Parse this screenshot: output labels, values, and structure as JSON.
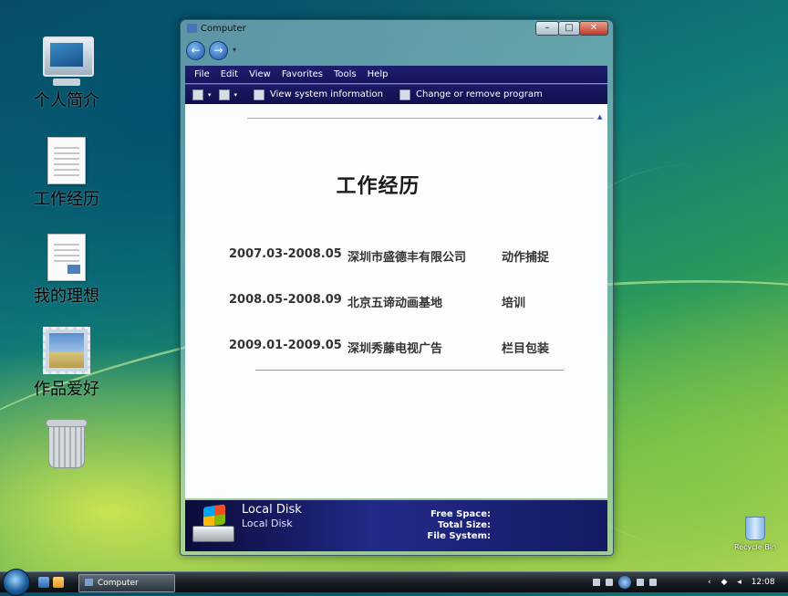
{
  "desktop": {
    "icons": [
      {
        "label": "个人简介",
        "icon": "computer-icon"
      },
      {
        "label": "工作经历",
        "icon": "document-icon"
      },
      {
        "label": "我的理想",
        "icon": "document-image-icon"
      },
      {
        "label": "作品爱好",
        "icon": "picture-frame-icon"
      },
      {
        "label": "",
        "icon": "trash-icon"
      }
    ],
    "recycle_bin_label": "Recycle Bin"
  },
  "window": {
    "title": "Computer",
    "controls": {
      "minimize": "–",
      "maximize": "□",
      "close": "✕"
    },
    "nav": {
      "back": "←",
      "forward": "→",
      "dropdown": "▾"
    },
    "menu": [
      "File",
      "Edit",
      "View",
      "Favorites",
      "Tools",
      "Help"
    ],
    "commands": {
      "views_dropdown": "▾",
      "layout_dropdown": "▾",
      "view_system_information": "View system information",
      "change_or_remove_program": "Change or remove program"
    },
    "content": {
      "collapse_glyph": "▲",
      "heading": "工作经历",
      "rows": [
        {
          "period": "2007.03-2008.05",
          "company": "深圳市盛德丰有限公司",
          "role": "动作捕捉"
        },
        {
          "period": "2008.05-2008.09",
          "company": "北京五谛动画基地",
          "role": "培训"
        },
        {
          "period": "2009.01-2009.05",
          "company": "深圳秀藤电视广告",
          "role": "栏目包装"
        }
      ]
    },
    "details": {
      "name": "Local Disk",
      "type": "Local Disk",
      "free_space_label": "Free Space:",
      "total_size_label": "Total Size:",
      "file_system_label": "File System:"
    }
  },
  "taskbar": {
    "task_button_label": "Computer",
    "tray_chevron": "‹",
    "clock": "12:08"
  }
}
